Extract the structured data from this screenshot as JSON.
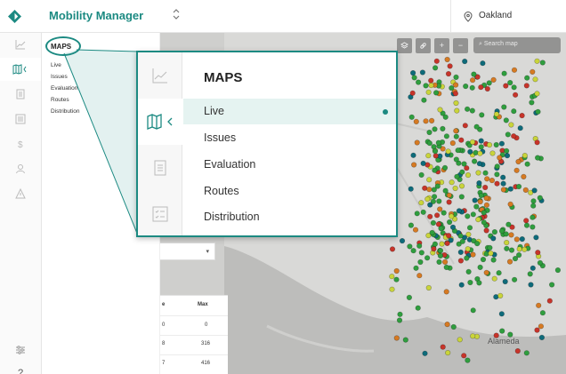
{
  "header": {
    "app_title": "Mobility Manager",
    "switcher_icon": "updown-chevron-icon",
    "location_icon": "map-pin-icon",
    "location": "Oakland"
  },
  "rail": {
    "items": [
      {
        "name": "chart-icon",
        "active": false
      },
      {
        "name": "map-icon",
        "active": true
      },
      {
        "name": "document-icon",
        "active": false
      },
      {
        "name": "checklist-icon",
        "active": false
      },
      {
        "name": "dollar-icon",
        "active": false
      },
      {
        "name": "users-icon",
        "active": false
      },
      {
        "name": "warning-icon",
        "active": false
      }
    ],
    "bottom_items": [
      {
        "name": "filter-settings-icon"
      },
      {
        "name": "help-icon",
        "text": "?"
      }
    ]
  },
  "subnav": {
    "title": "MAPS",
    "items": [
      "Live",
      "Issues",
      "Evaluation",
      "Routes",
      "Distribution"
    ]
  },
  "map": {
    "search_placeholder": "Search map",
    "tools": [
      "layers",
      "link",
      "+",
      "−"
    ],
    "place_labels": [
      "Alameda"
    ]
  },
  "table": {
    "headers": [
      "e",
      "Max"
    ],
    "rows": [
      [
        "0",
        "0"
      ],
      [
        "8",
        "316"
      ],
      [
        "7",
        "416"
      ]
    ]
  },
  "zoom_panel": {
    "title": "MAPS",
    "items": [
      "Live",
      "Issues",
      "Evaluation",
      "Routes",
      "Distribution"
    ],
    "active_item": "Live",
    "rail_icons": [
      "chart-icon",
      "map-icon",
      "document-icon",
      "checklist-icon"
    ]
  },
  "colors": {
    "accent": "#1c8a82",
    "dot_green": "#2f9e3e",
    "dot_yellow": "#c9d43a",
    "dot_orange": "#d67a22",
    "dot_red": "#c7342a",
    "dot_teal": "#0e6b7a"
  }
}
